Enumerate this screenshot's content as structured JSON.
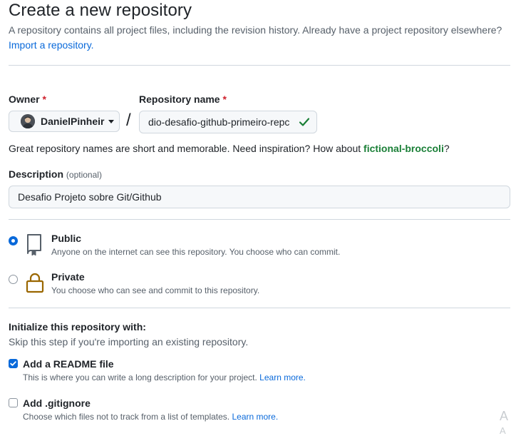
{
  "header": {
    "title": "Create a new repository",
    "intro": "A repository contains all project files, including the revision history. Already have a project repository elsewhere?",
    "import_link": "Import a repository."
  },
  "owner": {
    "label": "Owner",
    "required_mark": "*",
    "value": "DanielPinheir"
  },
  "separator": "/",
  "repository_name": {
    "label": "Repository name",
    "required_mark": "*",
    "value": "dio-desafio-github-primeiro-repc"
  },
  "name_hint": {
    "text": "Great repository names are short and memorable. Need inspiration? How about",
    "suggestion": "fictional-broccoli",
    "end": "?"
  },
  "description": {
    "label": "Description",
    "optional": "(optional)",
    "value": "Desafio Projeto sobre Git/Github"
  },
  "visibility": [
    {
      "title": "Public",
      "desc": "Anyone on the internet can see this repository. You choose who can commit.",
      "selected": true,
      "icon": "repo-icon"
    },
    {
      "title": "Private",
      "desc": "You choose who can see and commit to this repository.",
      "selected": false,
      "icon": "lock-icon"
    }
  ],
  "initialize": {
    "title": "Initialize this repository with:",
    "subtitle": "Skip this step if you're importing an existing repository.",
    "options": [
      {
        "title": "Add a README file",
        "desc": "This is where you can write a long description for your project.",
        "link": "Learn more.",
        "checked": true
      },
      {
        "title": "Add .gitignore",
        "desc": "Choose which files not to track from a list of templates.",
        "link": "Learn more.",
        "checked": false
      }
    ]
  },
  "colors": {
    "accent": "#0969da",
    "success": "#1a7f37",
    "danger": "#cf222e",
    "muted": "#57606a",
    "lock": "#9a6700"
  }
}
